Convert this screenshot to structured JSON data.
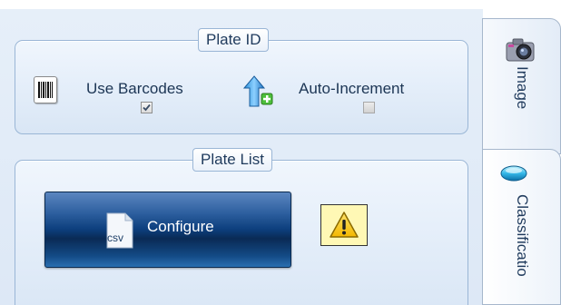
{
  "plate_id": {
    "title": "Plate ID",
    "use_barcodes": {
      "label": "Use Barcodes",
      "checked": true
    },
    "auto_increment": {
      "label": "Auto-Increment",
      "checked": false
    }
  },
  "plate_list": {
    "title": "Plate List",
    "configure_button": {
      "label": "Configure",
      "icon_text": "csv"
    }
  },
  "tabs": [
    {
      "label": "Image",
      "icon": "camera-icon"
    },
    {
      "label": "Classificatio",
      "icon": "lens-icon"
    }
  ],
  "colors": {
    "panel_bg": "#dde8f6",
    "button_dark": "#0a2a55",
    "warning_bg": "#fff8b5",
    "text": "#1c3554"
  }
}
